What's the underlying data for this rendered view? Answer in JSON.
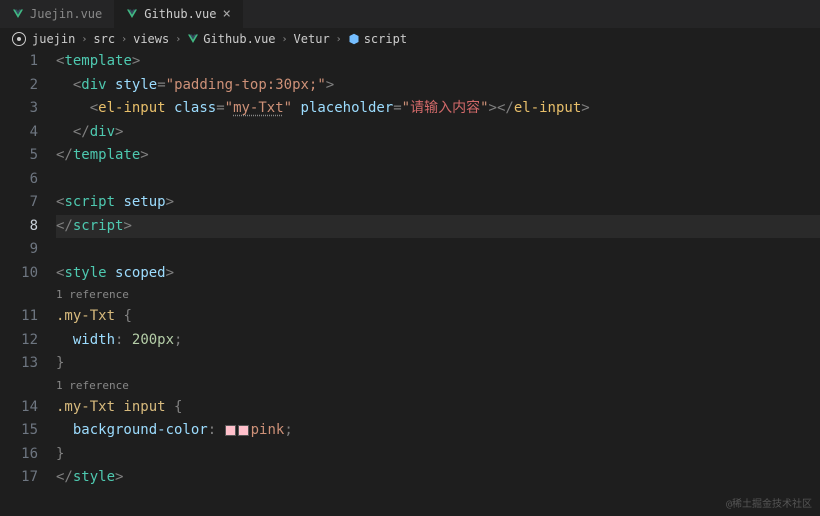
{
  "tabs": [
    {
      "label": "Juejin.vue",
      "active": false
    },
    {
      "label": "Github.vue",
      "active": true
    }
  ],
  "breadcrumbs": {
    "items": [
      "juejin",
      "src",
      "views",
      "Github.vue",
      "Vetur",
      "script"
    ]
  },
  "references": {
    "ref1": "1 reference",
    "ref2": "1 reference"
  },
  "code": {
    "l1": {
      "open": "<",
      "tag": "template",
      "close": ">"
    },
    "l2": {
      "open": "<",
      "tag": "div",
      "sp": " ",
      "attr": "style",
      "eq": "=",
      "q": "\"",
      "val": "padding-top:30px;",
      "q2": "\"",
      "close": ">"
    },
    "l3": {
      "open": "<",
      "tag": "el-input",
      "sp": " ",
      "attr1": "class",
      "eq": "=",
      "q": "\"",
      "val1": "my-Txt",
      "q2": "\"",
      "sp2": " ",
      "attr2": "placeholder",
      "eq2": "=",
      "q3": "\"",
      "val2": "请输入内容",
      "q4": "\"",
      "close": ">",
      "open2": "</",
      "tag2": "el-input",
      "close2": ">"
    },
    "l4": {
      "open": "</",
      "tag": "div",
      "close": ">"
    },
    "l5": {
      "open": "</",
      "tag": "template",
      "close": ">"
    },
    "l7": {
      "open": "<",
      "tag": "script",
      "sp": " ",
      "attr": "setup",
      "close": ">"
    },
    "l8": {
      "open": "</",
      "tag": "script",
      "close": ">"
    },
    "l10": {
      "open": "<",
      "tag": "style",
      "sp": " ",
      "attr": "scoped",
      "close": ">"
    },
    "l11": {
      "sel": ".my-Txt",
      "sp": " ",
      "brace": "{"
    },
    "l12": {
      "prop": "width",
      "colon": ":",
      "sp": " ",
      "val": "200px",
      "semi": ";"
    },
    "l13": {
      "brace": "}"
    },
    "l14": {
      "sel": ".my-Txt input",
      "sp": " ",
      "brace": "{"
    },
    "l15": {
      "prop": "background-color",
      "colon": ":",
      "sp": " ",
      "val": "pink",
      "semi": ";"
    },
    "l16": {
      "brace": "}"
    },
    "l17": {
      "open": "</",
      "tag": "style",
      "close": ">"
    }
  },
  "lineNumbers": [
    "1",
    "2",
    "3",
    "4",
    "5",
    "6",
    "7",
    "8",
    "9",
    "10",
    "11",
    "12",
    "13",
    "14",
    "15",
    "16",
    "17"
  ],
  "colors": {
    "pink": "#ffc0cb"
  },
  "watermark": "@稀土掘金技术社区"
}
